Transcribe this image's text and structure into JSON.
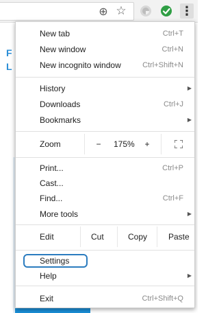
{
  "toolbar": {
    "icons": [
      "zoom-icon",
      "star-icon",
      "extension-icon",
      "check-extension-icon",
      "menu-kebab-icon"
    ],
    "check_color": "#2f9e44",
    "zoom_glyph": "⊕",
    "star_glyph": "☆",
    "kebab_glyph": "⋮"
  },
  "menu": {
    "new_tab": {
      "label": "New tab",
      "shortcut": "Ctrl+T"
    },
    "new_window": {
      "label": "New window",
      "shortcut": "Ctrl+N"
    },
    "new_incognito": {
      "label": "New incognito window",
      "shortcut": "Ctrl+Shift+N"
    },
    "history": {
      "label": "History",
      "arrow": "▶"
    },
    "downloads": {
      "label": "Downloads",
      "shortcut": "Ctrl+J"
    },
    "bookmarks": {
      "label": "Bookmarks",
      "arrow": "▶"
    },
    "zoom": {
      "label": "Zoom",
      "minus": "−",
      "value": "175%",
      "plus": "+"
    },
    "print": {
      "label": "Print...",
      "shortcut": "Ctrl+P"
    },
    "cast": {
      "label": "Cast..."
    },
    "find": {
      "label": "Find...",
      "shortcut": "Ctrl+F"
    },
    "more_tools": {
      "label": "More tools",
      "arrow": "▶"
    },
    "edit": {
      "label": "Edit",
      "cut": "Cut",
      "copy": "Copy",
      "paste": "Paste"
    },
    "settings": {
      "label": "Settings"
    },
    "help": {
      "label": "Help",
      "arrow": "▶"
    },
    "exit": {
      "label": "Exit",
      "shortcut": "Ctrl+Shift+Q"
    }
  },
  "page": {
    "strip_letters": [
      "F",
      "L"
    ],
    "accent_color": "#1a8fd8"
  },
  "highlight_color": "#2b7cbf"
}
